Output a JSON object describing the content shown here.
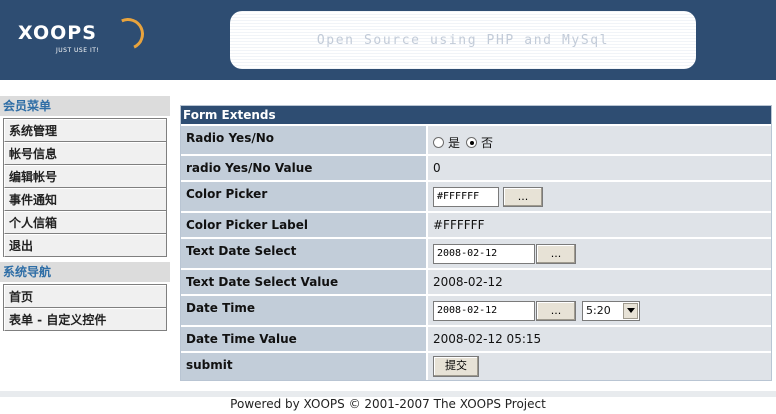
{
  "header": {
    "logo_text": "XOOPS",
    "logo_tagline": "JUST USE IT!",
    "slogan": "Open Source using PHP and MySql"
  },
  "sidebar": {
    "member_menu_title": "会员菜单",
    "member_items": [
      {
        "label": "系统管理"
      },
      {
        "label": "帐号信息"
      },
      {
        "label": "编辑帐号"
      },
      {
        "label": "事件通知"
      },
      {
        "label": "个人信箱"
      },
      {
        "label": "退出"
      }
    ],
    "nav_title": "系统导航",
    "nav_items": [
      {
        "label": "首页"
      },
      {
        "label": "表单 - 自定义控件"
      }
    ]
  },
  "form": {
    "title": "Form Extends",
    "rows": [
      {
        "label": "Radio Yes/No",
        "yes": "是",
        "no": "否",
        "selected": "no"
      },
      {
        "label": "radio Yes/No Value",
        "value": "0"
      },
      {
        "label": "Color Picker",
        "input_value": "#FFFFFF",
        "button": "..."
      },
      {
        "label": "Color Picker Label",
        "value": "#FFFFFF"
      },
      {
        "label": "Text Date Select",
        "input_value": "2008-02-12",
        "button": "..."
      },
      {
        "label": "Text Date Select Value",
        "value": "2008-02-12"
      },
      {
        "label": "Date Time",
        "input_value": "2008-02-12",
        "button": "...",
        "time_value": "5:20"
      },
      {
        "label": "Date Time Value",
        "value": "2008-02-12 05:15"
      },
      {
        "label": "submit",
        "button": "提交"
      }
    ]
  },
  "footer": {
    "prefix": "Powered by ",
    "brand": "XOOPS",
    "middle": " © 2001-2007 ",
    "project": "The XOOPS Project"
  }
}
